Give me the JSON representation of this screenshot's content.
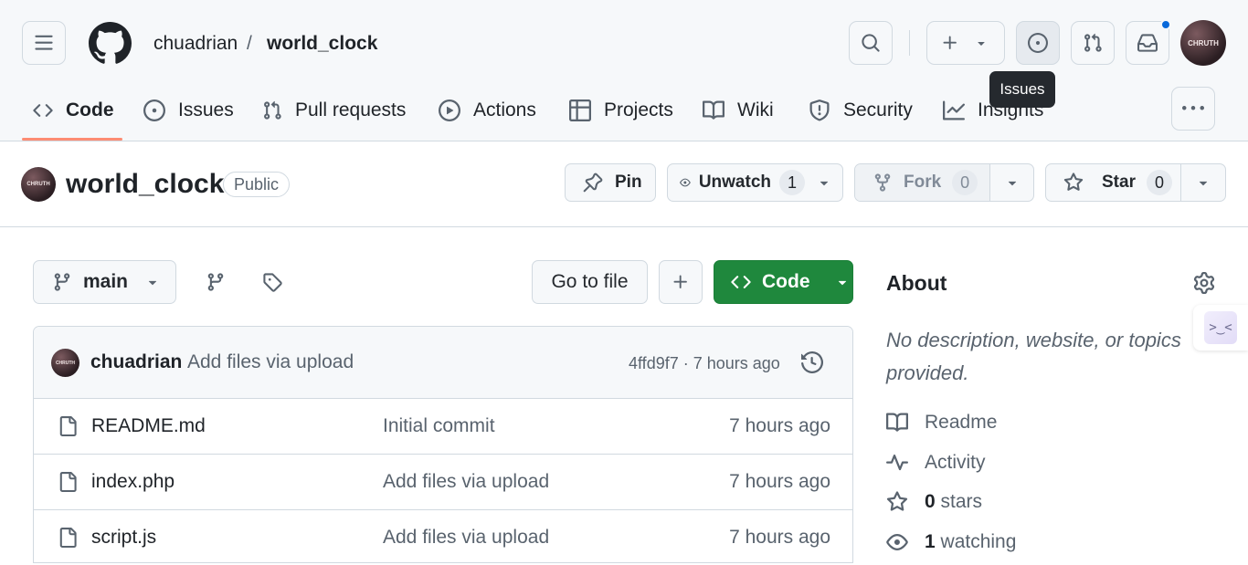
{
  "header": {
    "owner": "chuadrian",
    "separator": "/",
    "repo": "world_clock",
    "avatar_text": "CHRUTH",
    "tooltip": "Issues"
  },
  "tabs": [
    {
      "label": "Code",
      "icon": "code-icon",
      "active": true
    },
    {
      "label": "Issues",
      "icon": "issue-opened-icon"
    },
    {
      "label": "Pull requests",
      "icon": "git-pull-request-icon"
    },
    {
      "label": "Actions",
      "icon": "play-icon"
    },
    {
      "label": "Projects",
      "icon": "table-icon"
    },
    {
      "label": "Wiki",
      "icon": "book-icon"
    },
    {
      "label": "Security",
      "icon": "shield-icon"
    },
    {
      "label": "Insights",
      "icon": "graph-icon"
    }
  ],
  "repo": {
    "name": "world_clock",
    "visibility": "Public",
    "avatar_text": "CHRUTH",
    "pin_label": "Pin",
    "unwatch_label": "Unwatch",
    "watch_count": "1",
    "fork_label": "Fork",
    "fork_count": "0",
    "star_label": "Star",
    "star_count": "0"
  },
  "toolbar": {
    "branch": "main",
    "go_to_file": "Go to file",
    "add_icon": "plus-icon",
    "code_label": "Code"
  },
  "commit": {
    "author": "chuadrian",
    "message": "Add files via upload",
    "hash_time": "4ffd9f7 · 7 hours ago",
    "avatar_text": "CHRUTH"
  },
  "files": [
    {
      "name": "README.md",
      "message": "Initial commit",
      "time": "7 hours ago"
    },
    {
      "name": "index.php",
      "message": "Add files via upload",
      "time": "7 hours ago"
    },
    {
      "name": "script.js",
      "message": "Add files via upload",
      "time": "7 hours ago"
    }
  ],
  "about": {
    "title": "About",
    "description_line1": "No description, website, or topics",
    "description_line2": "provided.",
    "readme": "Readme",
    "activity": "Activity",
    "stars_count": "0",
    "stars_label": "stars",
    "watching_count": "1",
    "watching_label": "watching"
  },
  "colors": {
    "accent_green": "#1f883d",
    "tab_underline": "#fd8c73",
    "notification_dot": "#0969da"
  }
}
